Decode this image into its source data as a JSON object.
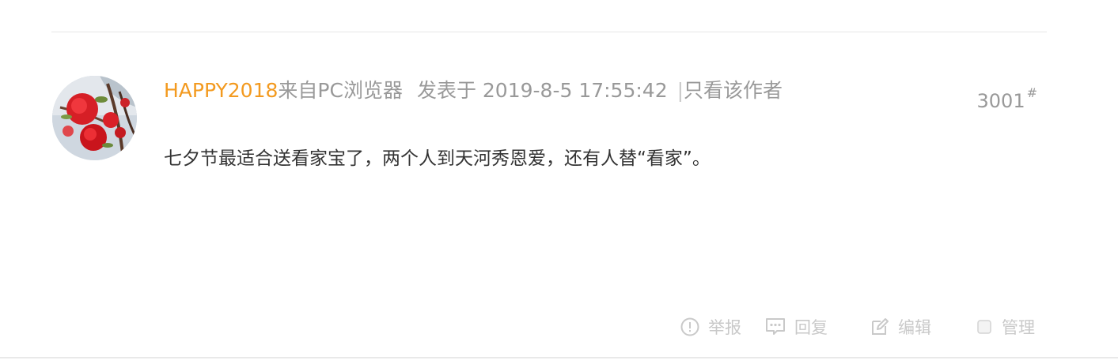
{
  "post": {
    "username": "HAPPY2018",
    "source": "来自PC浏览器",
    "posted_at": "发表于 2019-8-5 17:55:42",
    "divider": "|",
    "only_author_label": "只看该作者",
    "floor_number": "3001",
    "floor_suffix": "#",
    "content": "七夕节最适合送看家宝了，两个人到天河秀恩爱，还有人替“看家”。"
  },
  "actions": {
    "report_label": "举报",
    "reply_label": "回复",
    "edit_label": "编辑",
    "manage_label": "管理"
  },
  "icons": {
    "report": "alert-circle-icon",
    "reply": "comment-icon",
    "edit": "edit-icon",
    "manage": "checkbox-icon"
  },
  "colors": {
    "username": "#f39a1f",
    "meta_text": "#999999",
    "content_text": "#333333",
    "action_text": "#c9c9c9",
    "rule": "#e6e6e6"
  }
}
